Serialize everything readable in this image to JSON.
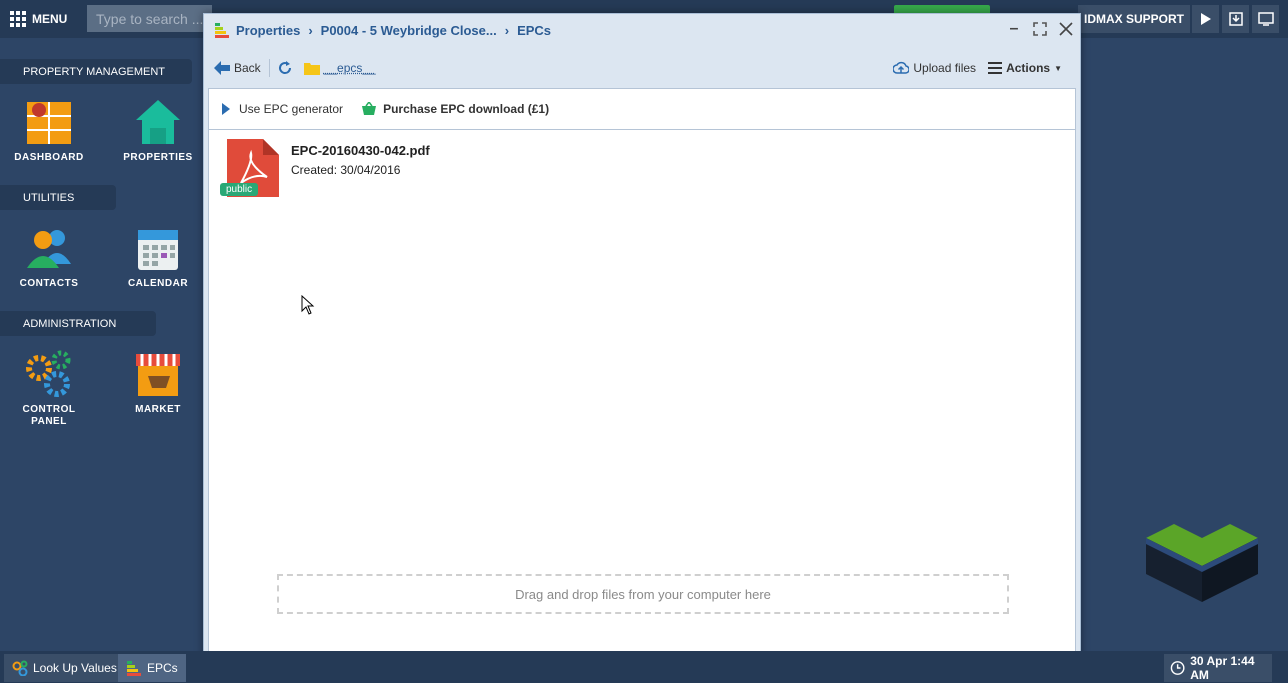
{
  "topbar": {
    "menu_label": "MENU",
    "search_placeholder": "Type to search ...",
    "support_label": "IDMAX SUPPORT"
  },
  "desktop": {
    "sections": [
      {
        "title": "PROPERTY MANAGEMENT"
      },
      {
        "title": "UTILITIES"
      },
      {
        "title": "ADMINISTRATION"
      }
    ],
    "tiles": {
      "dashboard": "DASHBOARD",
      "properties": "PROPERTIES",
      "contacts": "CONTACTS",
      "calendar": "CALENDAR",
      "control_panel_1": "CONTROL",
      "control_panel_2": "PANEL",
      "market": "MARKET"
    }
  },
  "window": {
    "breadcrumb": [
      "Properties",
      "P0004 - 5 Weybridge Close...",
      "EPCs"
    ],
    "toolbar": {
      "back": "Back",
      "folder": "__epcs__",
      "upload": "Upload files",
      "actions": "Actions"
    },
    "subbar": {
      "generator": "Use EPC generator",
      "purchase": "Purchase EPC download (£1)"
    },
    "files": [
      {
        "name": "EPC-20160430-042.pdf",
        "created": "Created: 30/04/2016",
        "badge": "public"
      }
    ],
    "dropzone": "Drag and drop files from your computer here"
  },
  "taskbar": {
    "tasks": [
      "Look Up Values",
      "EPCs"
    ],
    "clock": "30 Apr 1:44 AM"
  },
  "colors": {
    "desktop_bg": "#2d4566",
    "accent_blue": "#2b5b93",
    "badge_green": "#2aa876",
    "pdf_red": "#e04b3a"
  }
}
